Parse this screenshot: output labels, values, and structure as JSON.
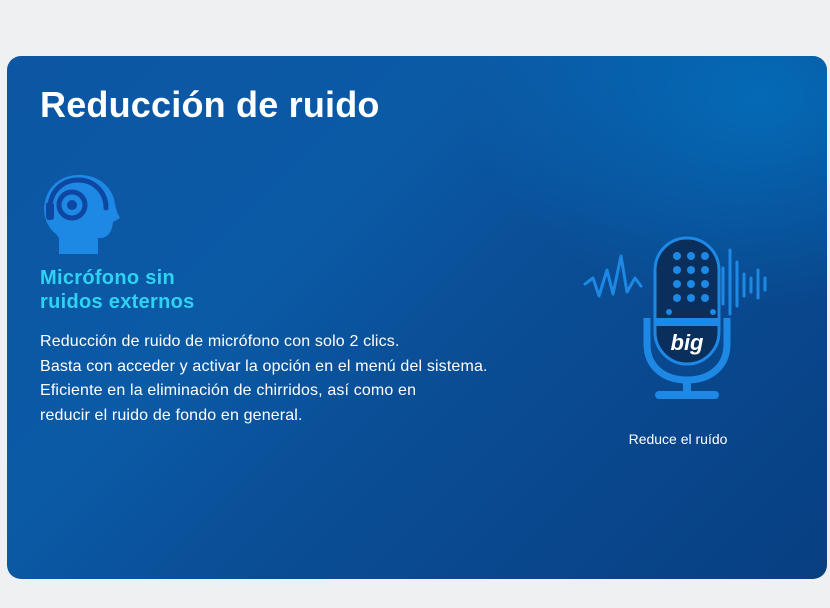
{
  "colors": {
    "card_background": "#0b5aa6",
    "heading_text": "#ffffff",
    "subtitle_text": "#2fd3f2",
    "icon_blue": "#1e88e5",
    "mic_dark": "#0a2f5c"
  },
  "section": {
    "title": "Reducción de ruido"
  },
  "feature": {
    "icon": "headset-head-icon",
    "subtitle_line1": "Micrófono sin",
    "subtitle_line2": "ruidos externos",
    "description": [
      "Reducción de ruido de micrófono con solo 2 clics.",
      "Basta con acceder y activar la opción en el menú del sistema.",
      "Eficiente en la eliminación de chirridos, así como en",
      "reducir el ruido de fondo en general."
    ]
  },
  "illustration": {
    "icon": "microphone-icon",
    "logo_text": "big",
    "caption": "Reduce el ruído"
  }
}
